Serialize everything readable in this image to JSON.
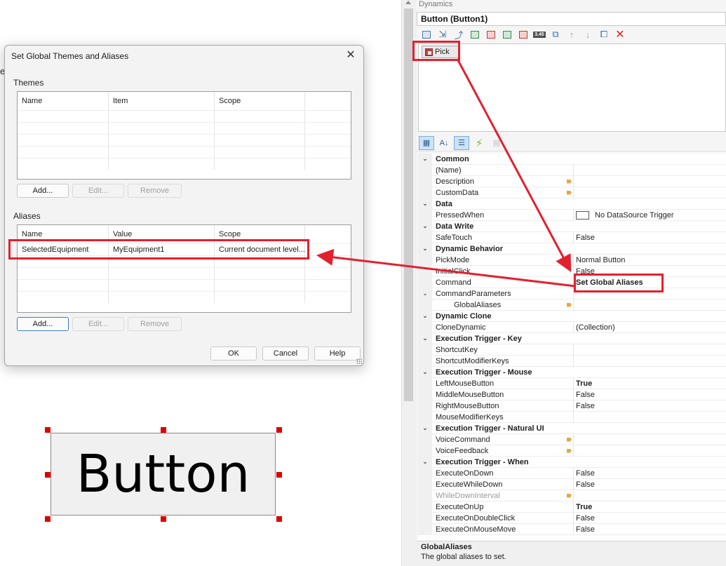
{
  "canvas": {
    "left_fragment": "e",
    "design_button_text": "Button"
  },
  "dynamics": {
    "header": "Dynamics",
    "object_title": "Button (Button1)",
    "toolbar_badge": "3.45",
    "pick_tab": "Pick",
    "property_groups": [
      {
        "category": "Common",
        "rows": [
          {
            "name": "(Name)",
            "value": ""
          },
          {
            "name": "Description",
            "value": "",
            "editor": true
          },
          {
            "name": "CustomData",
            "value": "",
            "editor": true
          }
        ]
      },
      {
        "category": "Data",
        "rows": [
          {
            "name": "PressedWhen",
            "value": "No DataSource Trigger",
            "checkbox": true
          }
        ]
      },
      {
        "category": "Data Write",
        "rows": [
          {
            "name": "SafeTouch",
            "value": "False"
          }
        ]
      },
      {
        "category": "Dynamic Behavior",
        "rows": [
          {
            "name": "PickMode",
            "value": "Normal Button"
          },
          {
            "name": "InitialClick",
            "value": "False"
          },
          {
            "name": "Command",
            "value": "Set Global Aliases",
            "bold": true
          },
          {
            "name": "CommandParameters",
            "value": "",
            "expandable": true
          },
          {
            "name": "GlobalAliases",
            "value": "",
            "editor": true,
            "indent": true
          }
        ]
      },
      {
        "category": "Dynamic Clone",
        "rows": [
          {
            "name": "CloneDynamic",
            "value": "(Collection)"
          }
        ]
      },
      {
        "category": "Execution Trigger - Key",
        "rows": [
          {
            "name": "ShortcutKey",
            "value": ""
          },
          {
            "name": "ShortcutModifierKeys",
            "value": ""
          }
        ]
      },
      {
        "category": "Execution Trigger - Mouse",
        "rows": [
          {
            "name": "LeftMouseButton",
            "value": "True",
            "bold": true
          },
          {
            "name": "MiddleMouseButton",
            "value": "False"
          },
          {
            "name": "RightMouseButton",
            "value": "False"
          },
          {
            "name": "MouseModifierKeys",
            "value": ""
          }
        ]
      },
      {
        "category": "Execution Trigger - Natural UI",
        "rows": [
          {
            "name": "VoiceCommand",
            "value": "",
            "editor": true
          },
          {
            "name": "VoiceFeedback",
            "value": "",
            "editor": true
          }
        ]
      },
      {
        "category": "Execution Trigger - When",
        "rows": [
          {
            "name": "ExecuteOnDown",
            "value": "False"
          },
          {
            "name": "ExecuteWhileDown",
            "value": "False"
          },
          {
            "name": "WhileDownInterval",
            "value": "",
            "editor": true,
            "disabled": true
          },
          {
            "name": "ExecuteOnUp",
            "value": "True",
            "bold": true
          },
          {
            "name": "ExecuteOnDoubleClick",
            "value": "False"
          },
          {
            "name": "ExecuteOnMouseMove",
            "value": "False"
          }
        ]
      }
    ],
    "description": {
      "title": "GlobalAliases",
      "text": "The global aliases to set."
    }
  },
  "dialog": {
    "title": "Set Global Themes and Aliases",
    "themes": {
      "label": "Themes",
      "columns": [
        "Name",
        "Item",
        "Scope"
      ],
      "rows": []
    },
    "aliases": {
      "label": "Aliases",
      "columns": [
        "Name",
        "Value",
        "Scope"
      ],
      "rows": [
        {
          "name": "SelectedEquipment",
          "value": "MyEquipment1",
          "scope": "Current document level..."
        }
      ]
    },
    "buttons": {
      "add": "Add...",
      "edit": "Edit...",
      "remove": "Remove",
      "ok": "OK",
      "cancel": "Cancel",
      "help": "Help"
    }
  },
  "colors": {
    "annotation": "#e3202e",
    "handle": "#e00000"
  }
}
